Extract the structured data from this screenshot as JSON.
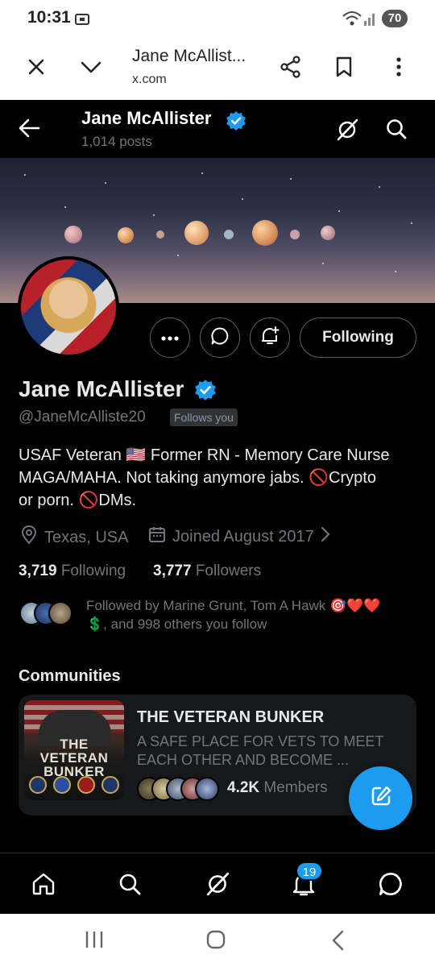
{
  "status_bar": {
    "time": "10:31",
    "battery": "70"
  },
  "browser": {
    "title": "Jane McAllist...",
    "url": "x.com"
  },
  "header": {
    "name": "Jane McAllister",
    "posts": "1,014 posts"
  },
  "profile": {
    "name": "Jane McAllister",
    "handle": "@JaneMcAlliste20",
    "follows_you": "Follows you",
    "bio_line1": "USAF Veteran 🇺🇸 Former RN - Memory Care Nurse",
    "bio_line2": "MAGA/MAHA. Not taking anymore jabs. 🚫Crypto",
    "bio_line3": "or porn. 🚫DMs.",
    "location": "Texas, USA",
    "joined": "Joined August 2017",
    "following_count": "3,719",
    "following_label": "Following",
    "followers_count": "3,777",
    "followers_label": "Followers",
    "followed_by_line1": "Followed by Marine Grunt, Tom A Hawk 🎯❤️❤️",
    "followed_by_line2": "💲, and 998 others you follow",
    "following_button": "Following"
  },
  "communities": {
    "section_title": "Communities",
    "items": [
      {
        "title": "THE VETERAN BUNKER",
        "description": "A SAFE PLACE FOR VETS TO MEET EACH OTHER AND BECOME ...",
        "members_count": "4.2K",
        "members_label": "Members",
        "image_text": "THE VETERAN BUNKER"
      }
    ]
  },
  "bottom_nav": {
    "notifications_badge": "19"
  },
  "colors": {
    "accent": "#1d9bf0",
    "background": "#000000",
    "muted": "#71767b",
    "text": "#e7e9ea"
  }
}
